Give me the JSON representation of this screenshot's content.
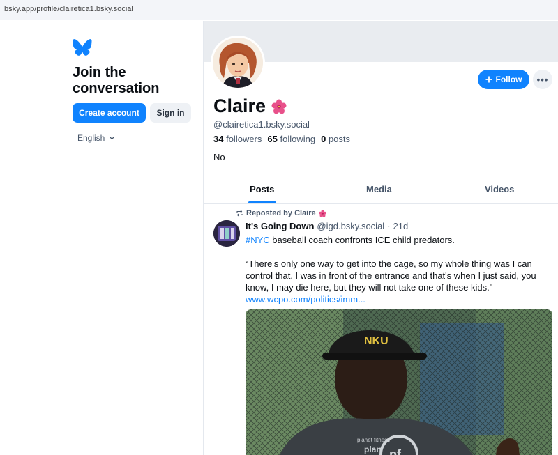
{
  "browser": {
    "url": "bsky.app/profile/clairetica1.bsky.social"
  },
  "sidebar": {
    "logo_icon": "butterfly-icon",
    "headline": "Join the conversation",
    "create_account": "Create account",
    "sign_in": "Sign in",
    "language": "English"
  },
  "profile": {
    "display_name": "Claire",
    "name_emoji": "hibiscus",
    "handle": "@clairetica1.bsky.social",
    "followers_count": "34",
    "followers_label": "followers",
    "following_count": "65",
    "following_label": "following",
    "posts_count": "0",
    "posts_label": "posts",
    "bio": "No",
    "follow_label": "Follow",
    "more_label": "•••"
  },
  "tabs": [
    {
      "label": "Posts",
      "active": true
    },
    {
      "label": "Media",
      "active": false
    },
    {
      "label": "Videos",
      "active": false
    }
  ],
  "post": {
    "repost_label": "Reposted by Claire",
    "author": "It's Going Down",
    "author_handle": "@igd.bsky.social",
    "separator": "·",
    "age": "21d",
    "hashtag": "#NYC",
    "line1_rest": " baseball coach confronts ICE child predators.",
    "quote": "“There's only one way to get into the cage, so my whole thing was I can control that. I was in front of the entrance and that's when I just said, you know, I may die here, but they will not take one of these kids.\"",
    "link": "www.wcpo.com/politics/imm...",
    "image_text_cap": "NKU",
    "image_text_shirt1": "planet fitness",
    "image_text_shirt2": "plan",
    "image_text_pf": "pf"
  },
  "colors": {
    "accent": "#1083fe",
    "muted": "#47566a"
  }
}
